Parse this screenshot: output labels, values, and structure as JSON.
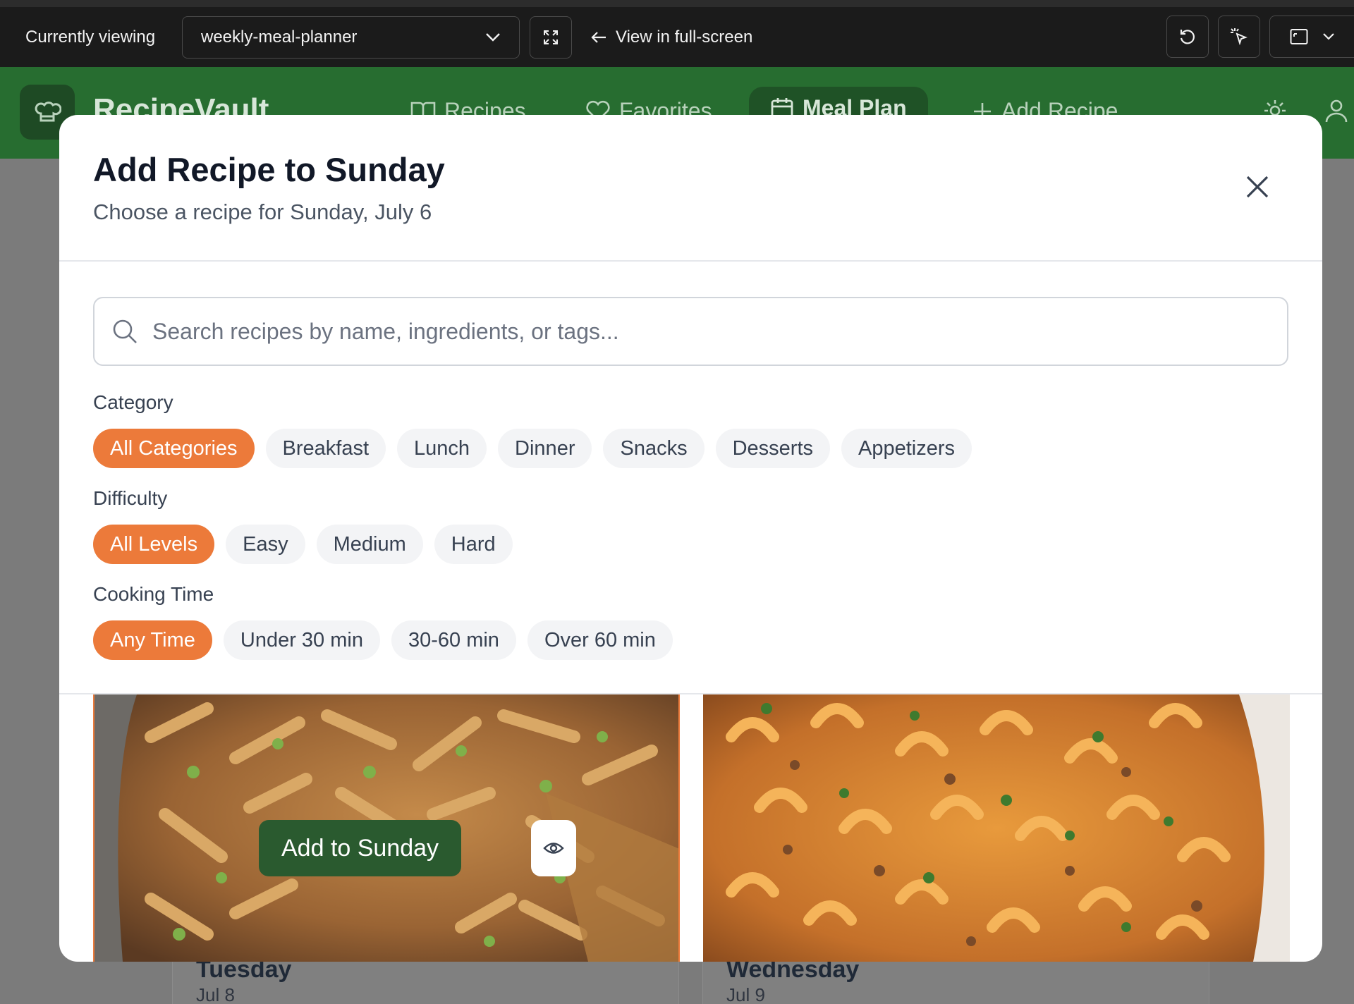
{
  "toolbar": {
    "currently_viewing_label": "Currently viewing",
    "project_select": "weekly-meal-planner",
    "fullscreen_link": "View in full-screen"
  },
  "app": {
    "brand": "RecipeVault",
    "nav": [
      {
        "label": "Recipes",
        "icon": "book-icon"
      },
      {
        "label": "Favorites",
        "icon": "heart-icon"
      },
      {
        "label": "Meal Plan",
        "icon": "calendar-icon",
        "active": true
      },
      {
        "label": "Add Recipe",
        "icon": "plus-icon"
      }
    ],
    "background_days": [
      {
        "day": "Tuesday",
        "date": "Jul 8"
      },
      {
        "day": "Wednesday",
        "date": "Jul 9"
      }
    ]
  },
  "modal": {
    "title": "Add Recipe to Sunday",
    "subtitle": "Choose a recipe for Sunday, July 6",
    "search_placeholder": "Search recipes by name, ingredients, or tags...",
    "filters": {
      "category": {
        "label": "Category",
        "options": [
          "All Categories",
          "Breakfast",
          "Lunch",
          "Dinner",
          "Snacks",
          "Desserts",
          "Appetizers"
        ],
        "selected": "All Categories"
      },
      "difficulty": {
        "label": "Difficulty",
        "options": [
          "All Levels",
          "Easy",
          "Medium",
          "Hard"
        ],
        "selected": "All Levels"
      },
      "cooking_time": {
        "label": "Cooking Time",
        "options": [
          "Any Time",
          "Under 30 min",
          "30-60 min",
          "Over 60 min"
        ],
        "selected": "Any Time"
      }
    },
    "add_button": "Add to Sunday"
  },
  "colors": {
    "accent_orange": "#ec7a3a",
    "brand_green": "#276d30",
    "button_green": "#2a5a2f"
  }
}
